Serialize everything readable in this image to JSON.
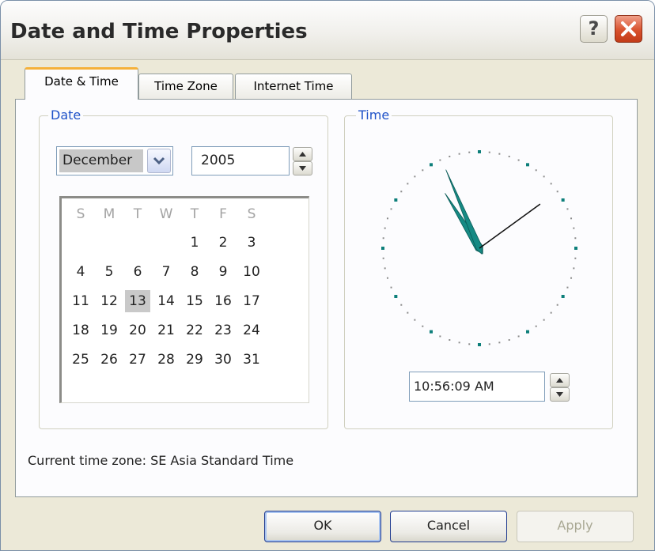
{
  "window": {
    "title": "Date and Time Properties",
    "help_label": "?",
    "accent_color": "#1f52c8",
    "close_color": "#d9522e"
  },
  "tabs": [
    {
      "label": "Date & Time",
      "active": true
    },
    {
      "label": "Time Zone",
      "active": false
    },
    {
      "label": "Internet Time",
      "active": false
    }
  ],
  "date_group": {
    "legend": "Date",
    "month": "December",
    "year": "2005",
    "weekdays": [
      "S",
      "M",
      "T",
      "W",
      "T",
      "F",
      "S"
    ],
    "days": [
      [
        "",
        "",
        "",
        "",
        "1",
        "2",
        "3"
      ],
      [
        "4",
        "5",
        "6",
        "7",
        "8",
        "9",
        "10"
      ],
      [
        "11",
        "12",
        "13",
        "14",
        "15",
        "16",
        "17"
      ],
      [
        "18",
        "19",
        "20",
        "21",
        "22",
        "23",
        "24"
      ],
      [
        "25",
        "26",
        "27",
        "28",
        "29",
        "30",
        "31"
      ]
    ],
    "selected_day": "13"
  },
  "time_group": {
    "legend": "Time",
    "time_value": "10:56:09 AM",
    "clock": {
      "hour": 10,
      "minute": 56,
      "second": 9
    }
  },
  "timezone_label": "Current time zone:  SE Asia Standard Time",
  "buttons": {
    "ok": "OK",
    "cancel": "Cancel",
    "apply": "Apply"
  }
}
